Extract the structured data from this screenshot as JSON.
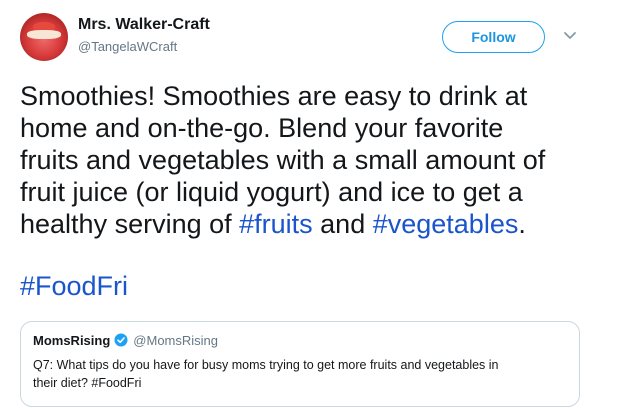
{
  "author": {
    "name": "Mrs. Walker-Craft",
    "handle": "@TangelaWCraft"
  },
  "follow_button": {
    "label": "Follow"
  },
  "tweet": {
    "segments": [
      {
        "text": "Smoothies!  Smoothies are easy to drink at"
      },
      {
        "text": "home and on-the-go.  Blend your favorite"
      },
      {
        "text": "fruits and vegetables with a small amount of"
      },
      {
        "text": "fruit juice (or liquid yogurt) and ice to get a"
      },
      {
        "pre": "healthy serving of ",
        "tag1": "#fruits",
        "mid": " and ",
        "tag2": "#vegetables",
        "post": "."
      }
    ],
    "hashtag_line": "#FoodFri"
  },
  "quoted_tweet": {
    "name": "MomsRising",
    "handle": "@MomsRising",
    "body_line1": "Q7: What tips do you have for busy moms trying to get more fruits and vegetables in",
    "body_line2": "their diet? #FoodFri"
  },
  "icons": {
    "avatar": "avatar-image",
    "caret": "chevron-down-icon",
    "verified": "verified-badge-icon"
  },
  "colors": {
    "accent": "#1da1f2",
    "hashtag": "#1b55cc",
    "secondary_text": "#657786"
  }
}
